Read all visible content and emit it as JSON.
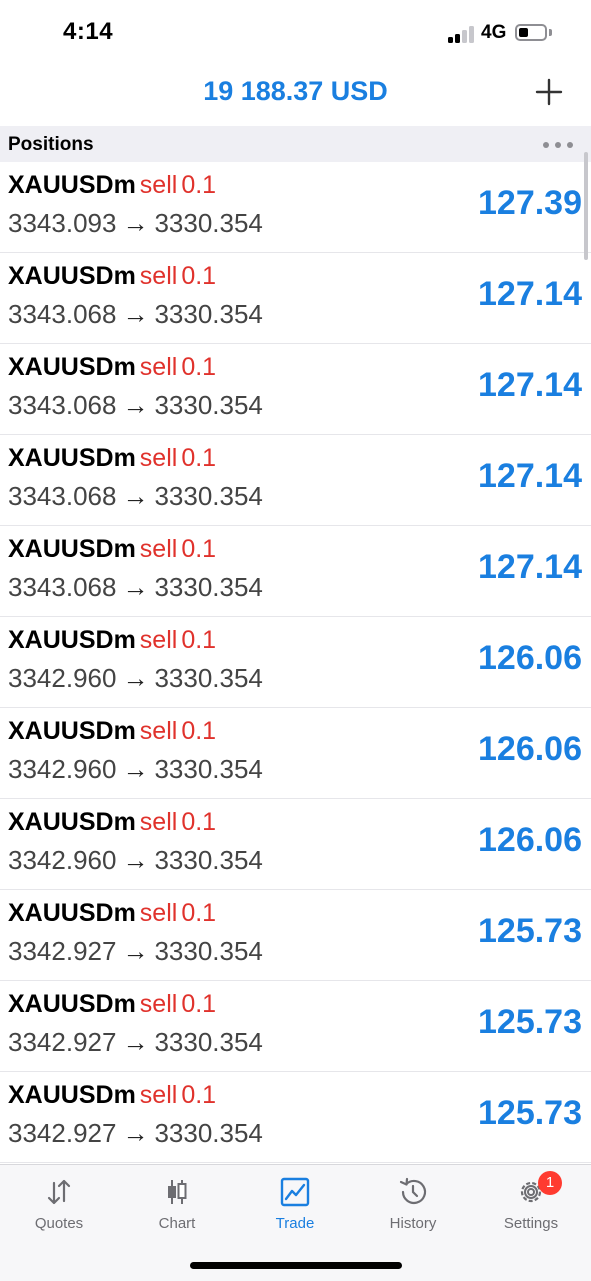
{
  "status_bar": {
    "time": "4:14",
    "network": "4G"
  },
  "header": {
    "balance": "19 188.37 USD"
  },
  "section": {
    "title": "Positions"
  },
  "positions": [
    {
      "symbol": "XAUUSDm",
      "side": "sell",
      "volume": "0.1",
      "open_price": "3343.093",
      "arrow": "→",
      "current_price": "3330.354",
      "profit": "127.39"
    },
    {
      "symbol": "XAUUSDm",
      "side": "sell",
      "volume": "0.1",
      "open_price": "3343.068",
      "arrow": "→",
      "current_price": "3330.354",
      "profit": "127.14"
    },
    {
      "symbol": "XAUUSDm",
      "side": "sell",
      "volume": "0.1",
      "open_price": "3343.068",
      "arrow": "→",
      "current_price": "3330.354",
      "profit": "127.14"
    },
    {
      "symbol": "XAUUSDm",
      "side": "sell",
      "volume": "0.1",
      "open_price": "3343.068",
      "arrow": "→",
      "current_price": "3330.354",
      "profit": "127.14"
    },
    {
      "symbol": "XAUUSDm",
      "side": "sell",
      "volume": "0.1",
      "open_price": "3343.068",
      "arrow": "→",
      "current_price": "3330.354",
      "profit": "127.14"
    },
    {
      "symbol": "XAUUSDm",
      "side": "sell",
      "volume": "0.1",
      "open_price": "3342.960",
      "arrow": "→",
      "current_price": "3330.354",
      "profit": "126.06"
    },
    {
      "symbol": "XAUUSDm",
      "side": "sell",
      "volume": "0.1",
      "open_price": "3342.960",
      "arrow": "→",
      "current_price": "3330.354",
      "profit": "126.06"
    },
    {
      "symbol": "XAUUSDm",
      "side": "sell",
      "volume": "0.1",
      "open_price": "3342.960",
      "arrow": "→",
      "current_price": "3330.354",
      "profit": "126.06"
    },
    {
      "symbol": "XAUUSDm",
      "side": "sell",
      "volume": "0.1",
      "open_price": "3342.927",
      "arrow": "→",
      "current_price": "3330.354",
      "profit": "125.73"
    },
    {
      "symbol": "XAUUSDm",
      "side": "sell",
      "volume": "0.1",
      "open_price": "3342.927",
      "arrow": "→",
      "current_price": "3330.354",
      "profit": "125.73"
    },
    {
      "symbol": "XAUUSDm",
      "side": "sell",
      "volume": "0.1",
      "open_price": "3342.927",
      "arrow": "→",
      "current_price": "3330.354",
      "profit": "125.73"
    }
  ],
  "tabs": [
    {
      "label": "Quotes",
      "icon": "quotes-icon",
      "active": false
    },
    {
      "label": "Chart",
      "icon": "chart-icon",
      "active": false
    },
    {
      "label": "Trade",
      "icon": "trade-icon",
      "active": true
    },
    {
      "label": "History",
      "icon": "history-icon",
      "active": false
    },
    {
      "label": "Settings",
      "icon": "settings-icon",
      "active": false,
      "badge": "1"
    }
  ],
  "colors": {
    "accent": "#1a7fe0",
    "sell": "#e0322c",
    "badge": "#ff3b30"
  }
}
